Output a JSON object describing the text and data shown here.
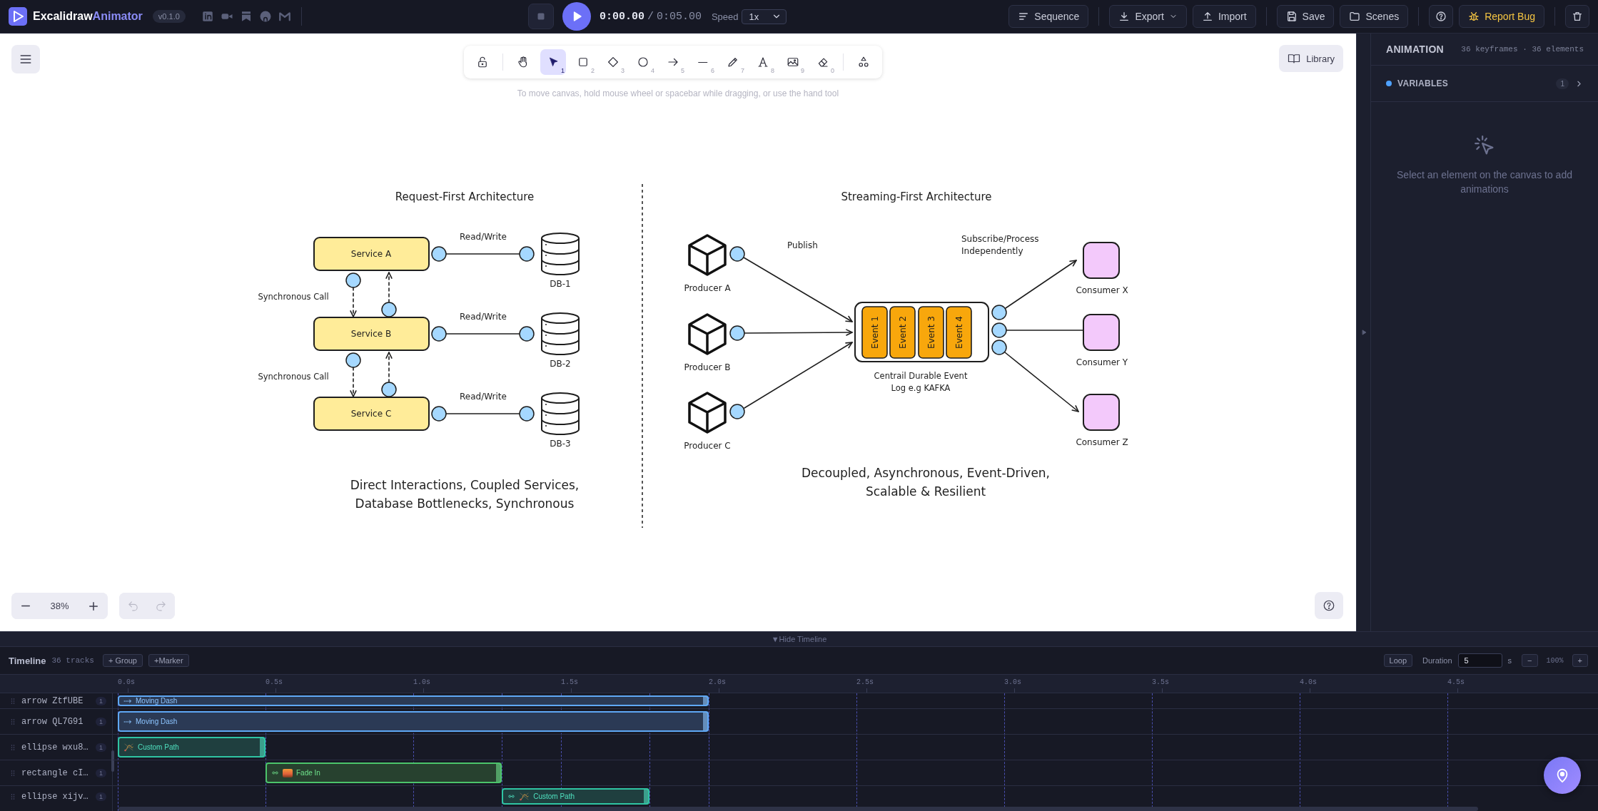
{
  "app_bar": {
    "title": "Excalidraw",
    "title_accent": "Animator",
    "version": "v0.1.0",
    "social_links": [
      {
        "kind": "profile"
      },
      {
        "kind": "video"
      },
      {
        "kind": "bookmark"
      },
      {
        "kind": "circle"
      },
      {
        "kind": "mail"
      }
    ],
    "playback": {
      "playing": false,
      "current_time": "0:00.00",
      "separator": "/",
      "total_time": "0:05.00",
      "speed_label": "Speed",
      "speed": "1x"
    },
    "actions": [
      {
        "kind": "sequence",
        "label": "Sequence"
      },
      {
        "kind": "export",
        "label": "Export"
      },
      {
        "kind": "import",
        "label": "Import"
      },
      {
        "kind": "save",
        "label": "Save"
      },
      {
        "kind": "scenes",
        "label": "Scenes"
      },
      {
        "kind": "help"
      },
      {
        "kind": "report",
        "label": "Report Bug"
      },
      {
        "kind": "delete"
      }
    ]
  },
  "canvas": {
    "tools": [
      {
        "kind": "lock",
        "selected": false
      },
      {
        "kind": "hand",
        "selected": false
      },
      {
        "kind": "select",
        "shortcut": "1",
        "selected": true
      },
      {
        "kind": "rectangle",
        "shortcut": "2",
        "selected": false
      },
      {
        "kind": "diamond",
        "shortcut": "3",
        "selected": false
      },
      {
        "kind": "ellipse",
        "shortcut": "4",
        "selected": false
      },
      {
        "kind": "arrow",
        "shortcut": "5",
        "selected": false
      },
      {
        "kind": "line",
        "shortcut": "6",
        "selected": false
      },
      {
        "kind": "draw",
        "shortcut": "7",
        "selected": false
      },
      {
        "kind": "text",
        "shortcut": "8",
        "selected": false
      },
      {
        "kind": "image",
        "shortcut": "9",
        "selected": false
      },
      {
        "kind": "eraser",
        "shortcut": "0",
        "selected": false
      },
      {
        "kind": "shapes",
        "selected": false
      }
    ],
    "hint": "To move canvas, hold mouse wheel or spacebar while dragging, or use the hand tool",
    "library": "Library",
    "zoom": "38%",
    "history": [
      {
        "kind": "undo",
        "disabled": true
      },
      {
        "kind": "redo",
        "disabled": true
      }
    ]
  },
  "diagram": {
    "request_first": {
      "title": "Request-First Architecture",
      "services": [
        {
          "label": "Service A",
          "edge_label": "Read/Write",
          "database": "DB-1"
        },
        {
          "label": "Service B",
          "edge_label": "Read/Write",
          "database": "DB-2"
        },
        {
          "label": "Service C",
          "edge_label": "Read/Write",
          "database": "DB-3"
        }
      ],
      "call_labels": [
        "Synchronous Call",
        "Synchronous Call"
      ],
      "caption": [
        "Direct Interactions, Coupled Services,",
        "Database Bottlenecks, Synchronous"
      ]
    },
    "streaming_first": {
      "title": "Streaming-First Architecture",
      "publish_label": "Publish",
      "producers": [
        "Producer A",
        "Producer B",
        "Producer C"
      ],
      "events": [
        "Event 1",
        "Event 2",
        "Event 3",
        "Event 4"
      ],
      "log_caption": [
        "Centrail Durable Event",
        "Log e.g KAFKA"
      ],
      "subscribe_caption": [
        "Subscribe/Process",
        "Independently"
      ],
      "consumers": [
        "Consumer X",
        "Consumer Y",
        "Consumer Z"
      ],
      "caption": [
        "Decoupled, Asynchronous, Event-Driven,",
        "Scalable & Resilient"
      ]
    }
  },
  "side_panel": {
    "title": "ANIMATION",
    "summary": "36 keyframes · 36 elements",
    "sections": [
      {
        "label": "VARIABLES",
        "count": "1",
        "expanded": false
      }
    ],
    "empty_text": "Select an element on the canvas to add animations"
  },
  "timeline": {
    "toggle": "▼Hide Timeline",
    "title": "Timeline",
    "track_count": "36 tracks",
    "add_buttons": [
      "+ Group",
      "+Marker"
    ],
    "loop": "Loop",
    "duration_label": "Duration",
    "duration": "5",
    "duration_unit": "s",
    "zoom_out": "−",
    "zoom": "100%",
    "zoom_in": "+",
    "ticks": [
      "0.0s",
      "0.5s",
      "1.0s",
      "1.5s",
      "2.0s",
      "2.5s",
      "3.0s",
      "3.5s",
      "4.0s",
      "4.5s"
    ],
    "tracks": [
      {
        "name": "arrow ZtfUBE",
        "count": "1",
        "clips": [
          {
            "kind": "moving-dash",
            "label": "Moving Dash",
            "linked": false
          }
        ]
      },
      {
        "name": "arrow QL7G91",
        "count": "1",
        "clips": [
          {
            "kind": "moving-dash",
            "label": "Moving Dash",
            "linked": false
          }
        ]
      },
      {
        "name": "ellipse wxu8…",
        "count": "1",
        "clips": [
          {
            "kind": "custom-path",
            "label": "Custom Path",
            "linked": false
          }
        ]
      },
      {
        "name": "rectangle cI…",
        "count": "1",
        "clips": [
          {
            "kind": "fade-in",
            "label": "Fade In",
            "linked": true
          }
        ]
      },
      {
        "name": "ellipse xijv…",
        "count": "1",
        "clips": [
          {
            "kind": "custom-path",
            "label": "Custom Path",
            "linked": true
          }
        ]
      }
    ]
  }
}
